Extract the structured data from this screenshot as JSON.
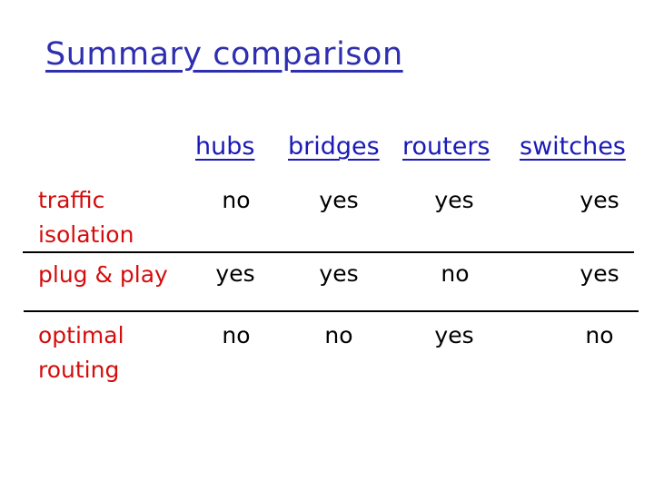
{
  "slide": {
    "title": "Summary comparison",
    "columns": [
      "hubs",
      "bridges",
      "routers",
      "switches"
    ],
    "rows": [
      {
        "label_lines": [
          "traffic",
          "isolation"
        ],
        "values": [
          "no",
          "yes",
          "yes",
          "yes"
        ]
      },
      {
        "label_lines": [
          "plug & play"
        ],
        "values": [
          "yes",
          "yes",
          "no",
          "yes"
        ]
      },
      {
        "label_lines": [
          "optimal",
          "routing"
        ],
        "values": [
          "no",
          "no",
          "yes",
          "no"
        ]
      }
    ],
    "colors": {
      "title": "#2e2eb0",
      "header": "#1a1ab8",
      "row_label": "#d40d0d",
      "cell": "#000000"
    }
  }
}
